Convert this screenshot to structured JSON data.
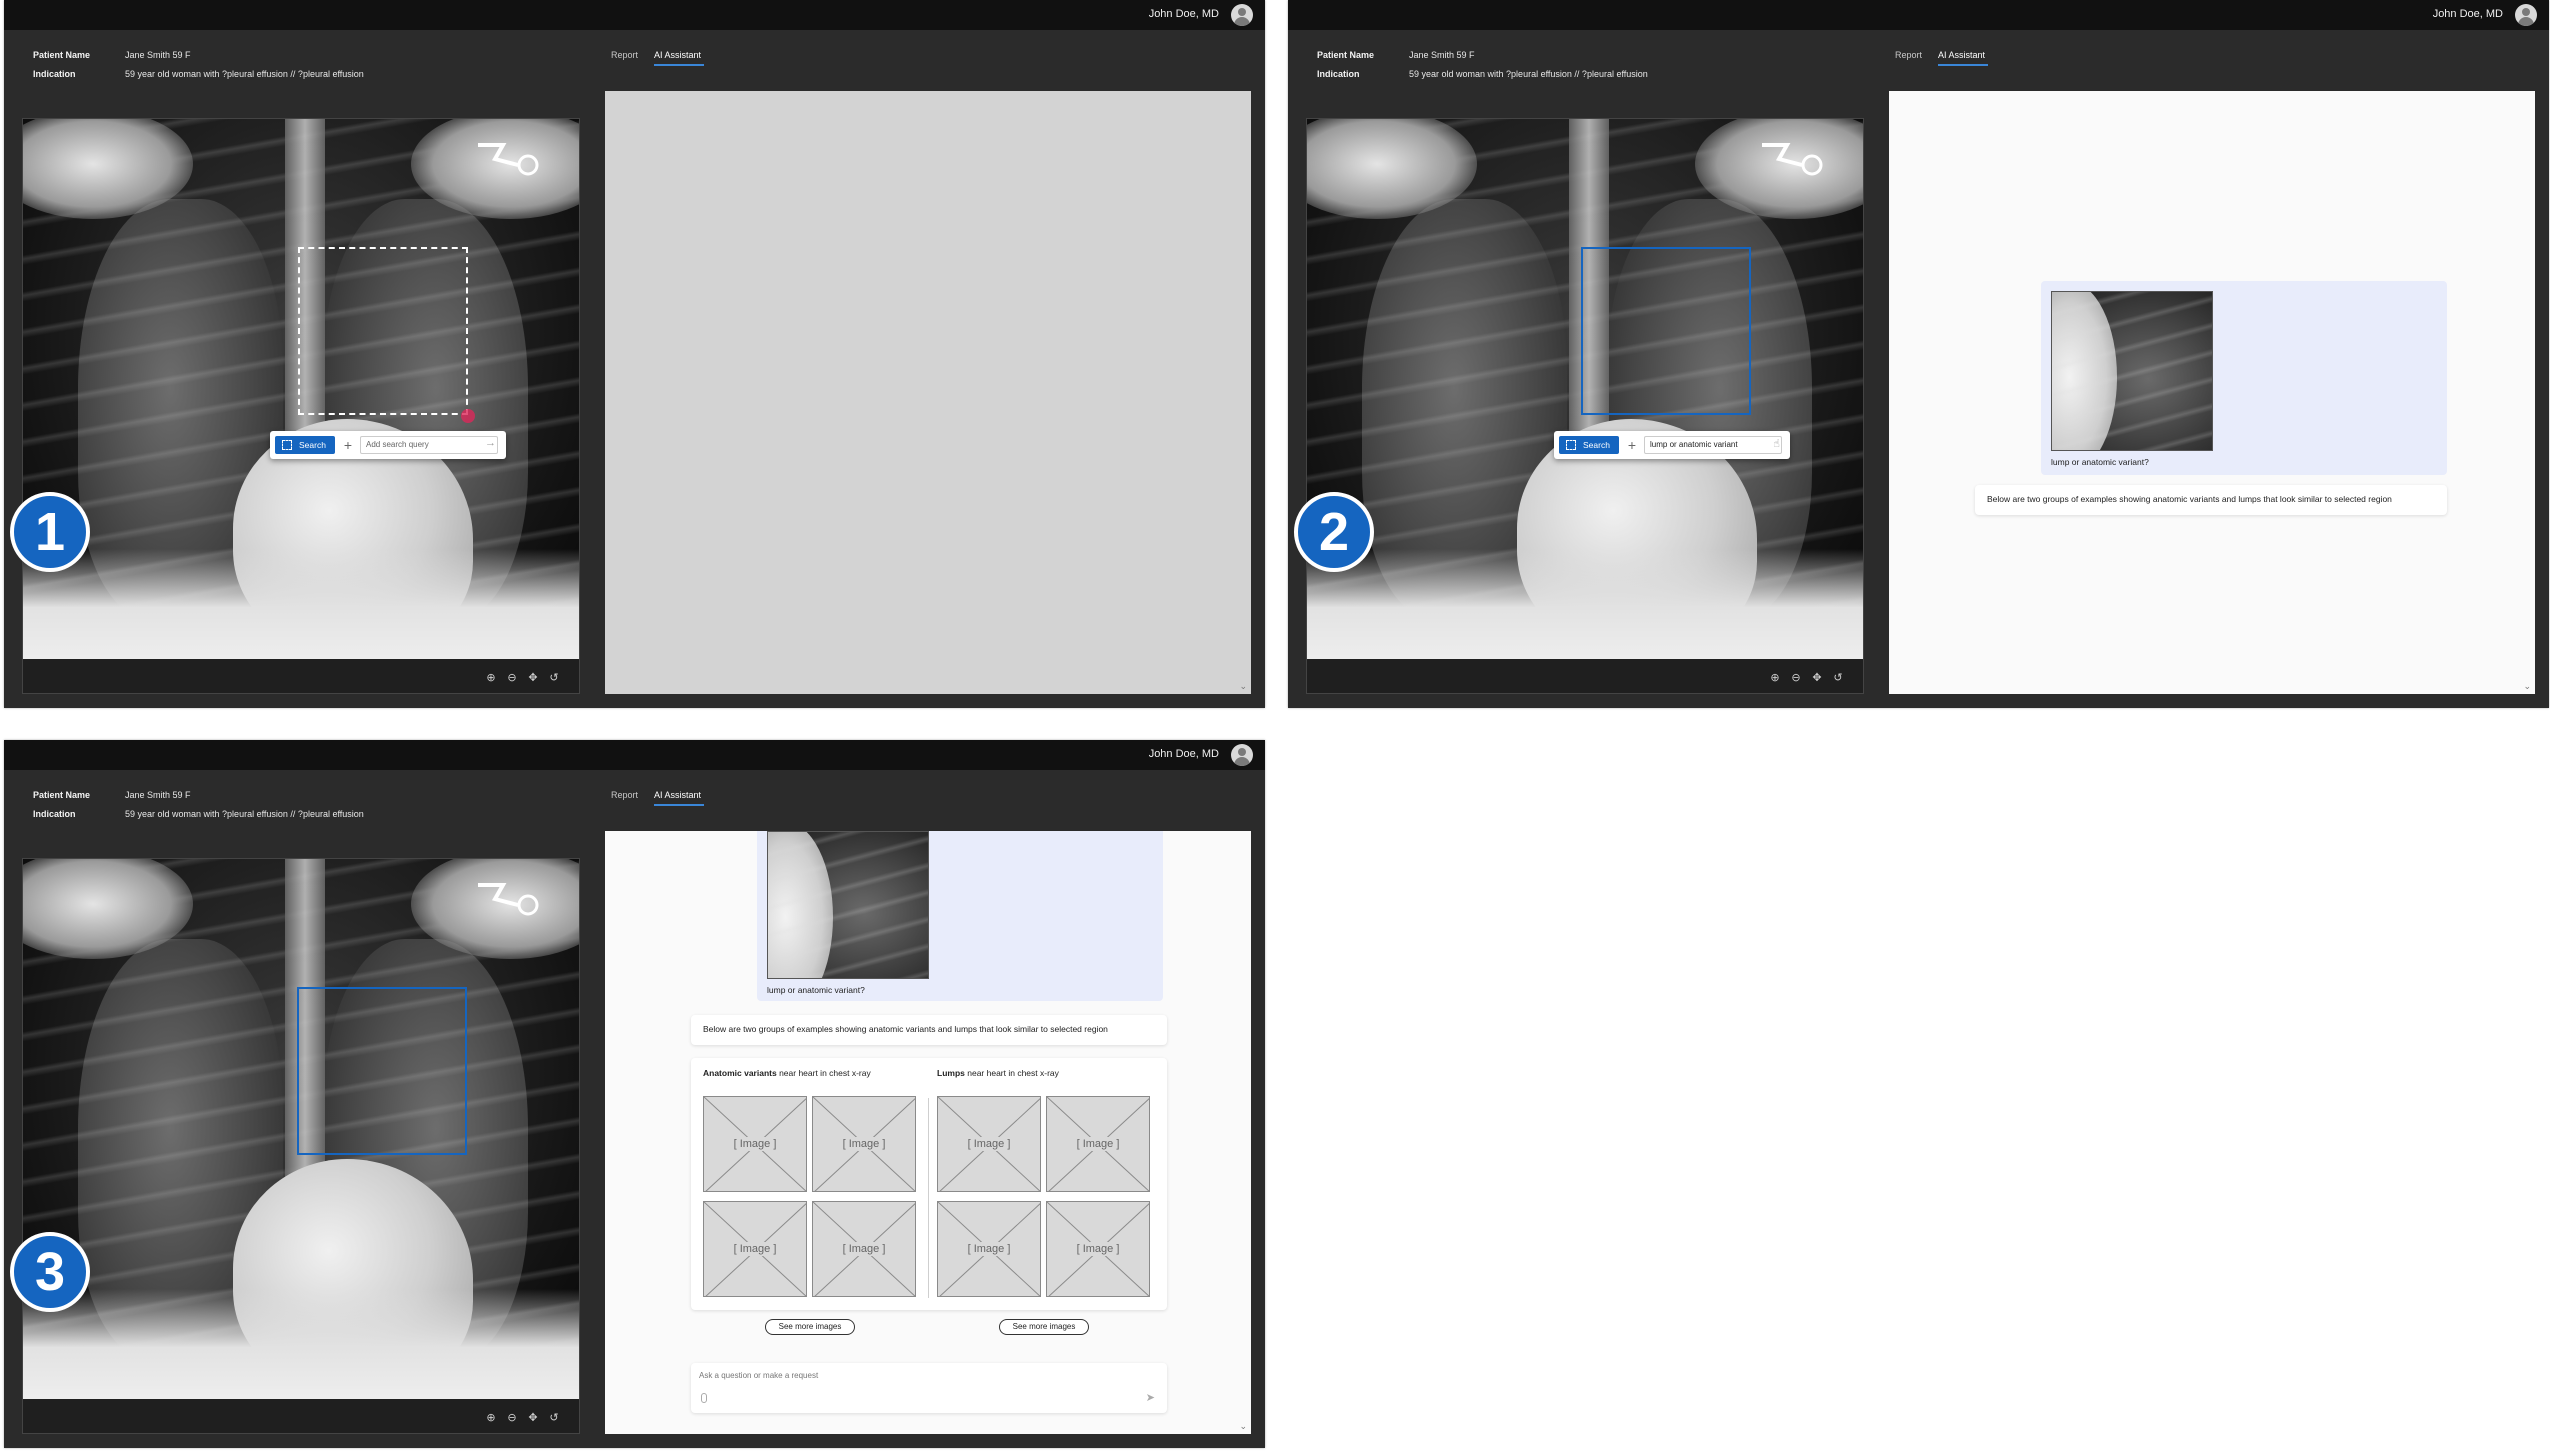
{
  "header": {
    "user_name": "John Doe, MD",
    "avatar_icon": "user-avatar-icon"
  },
  "patient": {
    "name_label": "Patient Name",
    "name_value": "Jane Smith 59 F",
    "indication_label": "Indication",
    "indication_value": "59 year old woman with ?pleural effusion // ?pleural effusion"
  },
  "tabs": {
    "report": "Report",
    "ai_assistant": "AI Assistant",
    "active": "AI Assistant"
  },
  "steps": [
    "1",
    "2",
    "3"
  ],
  "search": {
    "button_label": "Search",
    "plus_label": "+",
    "placeholder": "Add search query",
    "query_value": "lump or anatomic variant"
  },
  "chat": {
    "user_query": "lump or anatomic variant?",
    "ai_response": "Below are two groups of examples showing anatomic variants and lumps that look similar to selected region"
  },
  "results": {
    "groups": [
      {
        "title_bold": "Anatomic variants",
        "title_rest": " near heart in chest x-ray",
        "see_more": "See more images",
        "images": [
          "[ Image ]",
          "[ Image ]",
          "[ Image ]",
          "[ Image ]"
        ]
      },
      {
        "title_bold": "Lumps",
        "title_rest": " near heart in chest x-ray",
        "see_more": "See more images",
        "images": [
          "[ Image ]",
          "[ Image ]",
          "[ Image ]",
          "[ Image ]"
        ]
      }
    ]
  },
  "input": {
    "placeholder": "Ask a question or make a request"
  },
  "colors": {
    "accent": "#1565c0",
    "background": "#2b2b2b",
    "topbar": "#111111",
    "user_message_bg": "#e8ecfb"
  },
  "viewer_tools": [
    "zoom-in-icon",
    "zoom-out-icon",
    "pan-icon",
    "reset-icon"
  ]
}
